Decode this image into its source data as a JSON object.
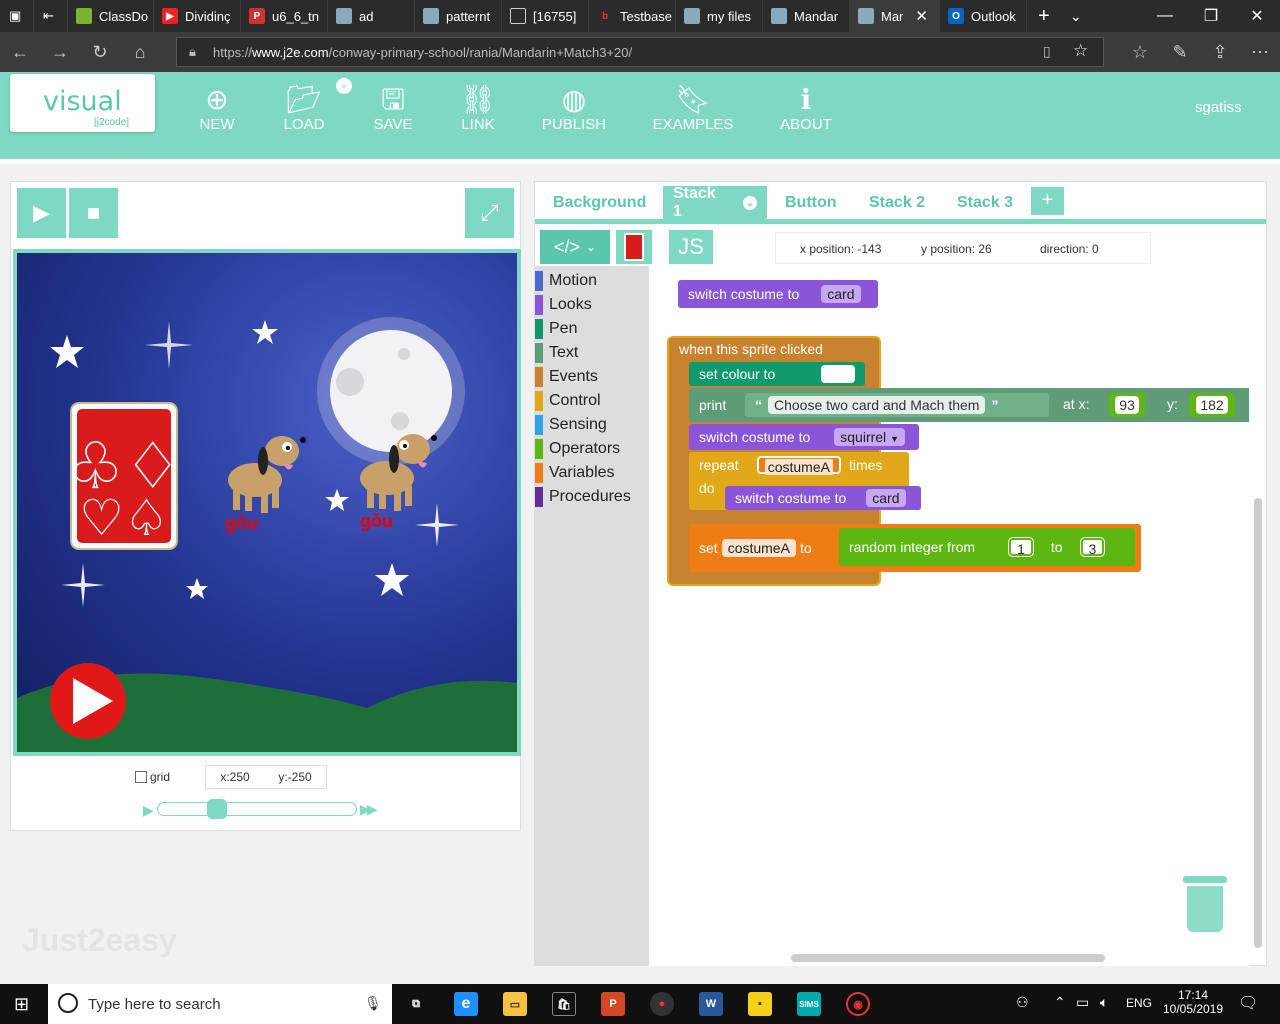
{
  "browser": {
    "tabs": [
      "ClassDo",
      "Dividinç",
      "u6_6_tn",
      "ad",
      "patternt",
      "[16755]",
      "Testbase",
      "my files",
      "Mandar",
      "Mar",
      "Outlook"
    ],
    "url_prefix": "https://",
    "url_domain": "www.j2e.com",
    "url_path": "/conway-primary-school/rania/Mandarin+Match3+20/"
  },
  "app": {
    "logo_main": "visual",
    "logo_sub": "[j2code]",
    "nav": [
      "NEW",
      "LOAD",
      "SAVE",
      "LINK",
      "PUBLISH",
      "EXAMPLES",
      "ABOUT"
    ],
    "user": "sgatiss"
  },
  "stage": {
    "sprite_label_1": "gǒu",
    "sprite_label_2": "gǒu",
    "grid_label": "grid",
    "coord_x": "x:250",
    "coord_y": "y:-250",
    "watermark": "Just2easy"
  },
  "editor": {
    "tabs": [
      "Background",
      "Stack 1",
      "Button",
      "Stack 2",
      "Stack 3"
    ],
    "add_tab": "+",
    "js_label": "JS",
    "sprite_info": {
      "x_position": "x position: -143",
      "y_position": "y position: 26",
      "direction": "direction: 0"
    },
    "categories": [
      {
        "name": "Motion",
        "color": "#4a6cd4"
      },
      {
        "name": "Looks",
        "color": "#8a55d7"
      },
      {
        "name": "Pen",
        "color": "#0e9a6c"
      },
      {
        "name": "Text",
        "color": "#5e9b76"
      },
      {
        "name": "Events",
        "color": "#c88330"
      },
      {
        "name": "Control",
        "color": "#e1a91a"
      },
      {
        "name": "Sensing",
        "color": "#2ca5e2"
      },
      {
        "name": "Operators",
        "color": "#5cb712"
      },
      {
        "name": "Variables",
        "color": "#ee7d16"
      },
      {
        "name": "Procedures",
        "color": "#632d99"
      }
    ],
    "blocks": {
      "loose_switch": "switch costume to",
      "loose_switch_value": "card",
      "hat": "when this sprite clicked",
      "set_colour": "set colour to",
      "print": "print",
      "print_text": "Choose two card and Mach them",
      "at_x": "at x:",
      "x_val": "93",
      "y_label": "y:",
      "y_val": "182",
      "switch2": "switch costume to",
      "switch2_value": "squirrel",
      "repeat": "repeat",
      "repeat_var": "costumeA",
      "times": "times",
      "do": "do",
      "switch3": "switch costume to",
      "switch3_value": "card",
      "set": "set",
      "set_var": "costumeA",
      "to": "to",
      "random": "random integer from",
      "rand_from": "1",
      "rand_to_label": "to",
      "rand_to": "3"
    }
  },
  "taskbar": {
    "search_placeholder": "Type here to search",
    "lang": "ENG",
    "time": "17:14",
    "date": "10/05/2019",
    "sims": "SIMS"
  }
}
